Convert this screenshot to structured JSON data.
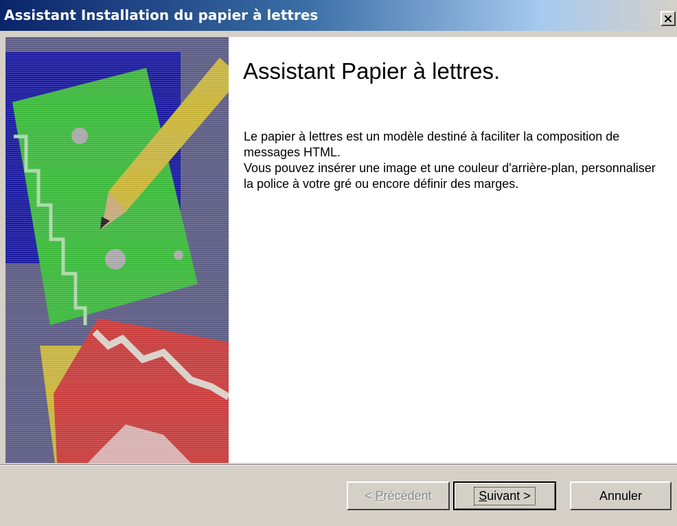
{
  "window": {
    "title": "Assistant Installation du papier à lettres",
    "close_glyph": "×"
  },
  "main": {
    "heading": "Assistant Papier à lettres.",
    "paragraph1": "Le papier à lettres est un modèle destiné à faciliter la composition de messages HTML.",
    "paragraph2": "Vous pouvez insérer une image et une couleur d'arrière-plan, personnaliser la police à votre gré ou encore définir des marges."
  },
  "buttons": {
    "back_prefix": "< ",
    "back_accel": "P",
    "back_rest": "récédent",
    "next_accel": "S",
    "next_rest": "uivant >",
    "cancel": "Annuler"
  },
  "colors": {
    "title_bar_start": "#0a246a",
    "face": "#d4d0c8",
    "art_blue": "#1a1aa0",
    "art_green": "#3cb83c",
    "art_yellow": "#c8b43c",
    "art_red": "#c83c3c"
  },
  "icons": {
    "close": "close-icon",
    "wizard_art": "stationery-illustration"
  }
}
